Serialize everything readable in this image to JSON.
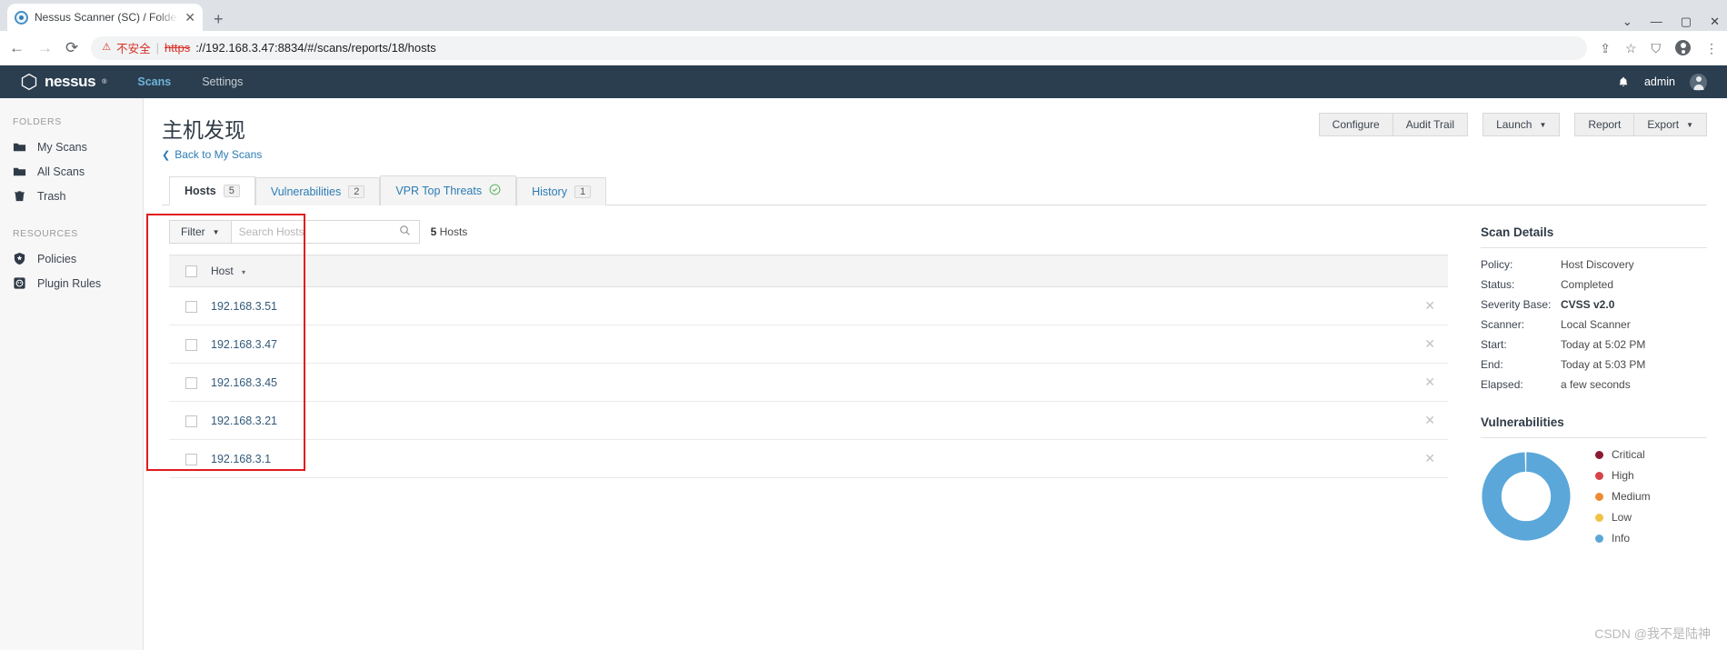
{
  "browser": {
    "tab_title": "Nessus Scanner (SC) / Folders",
    "tab_close": "✕",
    "new_tab": "+",
    "back": "←",
    "forward": "→",
    "reload": "⟳",
    "warn_icon": "⚠",
    "warn_text": "不安全",
    "separator": "|",
    "url_scheme": "https",
    "url_rest": "://192.168.3.47:8834/#/scans/reports/18/hosts",
    "share_icon": "⇪",
    "star_icon": "☆",
    "extension_icon": "⛉",
    "menu_icon": "⋮",
    "minimize": "—",
    "maximize": "▢",
    "close": "✕",
    "more": "⌄"
  },
  "header": {
    "brand": "nessus",
    "trademark": "®",
    "nav": [
      {
        "label": "Scans",
        "active": true
      },
      {
        "label": "Settings",
        "active": false
      }
    ],
    "bell_icon": "🔔",
    "user": "admin"
  },
  "sidebar": {
    "folders_heading": "FOLDERS",
    "folders": [
      {
        "label": "My Scans",
        "icon": "folder-icon"
      },
      {
        "label": "All Scans",
        "icon": "folder-icon"
      },
      {
        "label": "Trash",
        "icon": "trash-icon"
      }
    ],
    "resources_heading": "RESOURCES",
    "resources": [
      {
        "label": "Policies",
        "icon": "shield-icon"
      },
      {
        "label": "Plugin Rules",
        "icon": "plugin-icon"
      }
    ]
  },
  "page": {
    "title": "主机发现",
    "back_label": "Back to My Scans",
    "back_chevron": "❮"
  },
  "actions": {
    "configure": "Configure",
    "audit_trail": "Audit Trail",
    "launch": "Launch",
    "report": "Report",
    "export": "Export",
    "caret": "▼"
  },
  "tabs": [
    {
      "label": "Hosts",
      "badge": "5",
      "active": true
    },
    {
      "label": "Vulnerabilities",
      "badge": "2",
      "active": false
    },
    {
      "label": "VPR Top Threats",
      "badge": "",
      "check": "✓",
      "active": false
    },
    {
      "label": "History",
      "badge": "1",
      "active": false
    }
  ],
  "filter": {
    "filter_label": "Filter",
    "caret": "▼",
    "search_placeholder": "Search Hosts",
    "search_value": "",
    "search_icon": "⌕",
    "count_number": "5",
    "count_label": "Hosts"
  },
  "table": {
    "columns": [
      "Host"
    ],
    "sort_caret": "▾",
    "delete_icon": "✕",
    "rows": [
      {
        "host": "192.168.3.51"
      },
      {
        "host": "192.168.3.47"
      },
      {
        "host": "192.168.3.45"
      },
      {
        "host": "192.168.3.21"
      },
      {
        "host": "192.168.3.1"
      }
    ]
  },
  "scan_details": {
    "title": "Scan Details",
    "rows": [
      {
        "key": "Policy:",
        "value": "Host Discovery",
        "bold": false
      },
      {
        "key": "Status:",
        "value": "Completed",
        "bold": false
      },
      {
        "key": "Severity Base:",
        "value": "CVSS v2.0",
        "bold": true
      },
      {
        "key": "Scanner:",
        "value": "Local Scanner",
        "bold": false
      },
      {
        "key": "Start:",
        "value": "Today at 5:02 PM",
        "bold": false
      },
      {
        "key": "End:",
        "value": "Today at 5:03 PM",
        "bold": false
      },
      {
        "key": "Elapsed:",
        "value": "a few seconds",
        "bold": false
      }
    ]
  },
  "chart_data": {
    "type": "pie",
    "title": "Vulnerabilities",
    "categories": [
      "Critical",
      "High",
      "Medium",
      "Low",
      "Info"
    ],
    "values": [
      0,
      0,
      0,
      0,
      100
    ],
    "colors": [
      "#8b1a33",
      "#d8434a",
      "#ec8b34",
      "#f2c245",
      "#5ba7d9"
    ],
    "legend_position": "right",
    "donut": true
  },
  "watermark": "CSDN @我不是陆神"
}
